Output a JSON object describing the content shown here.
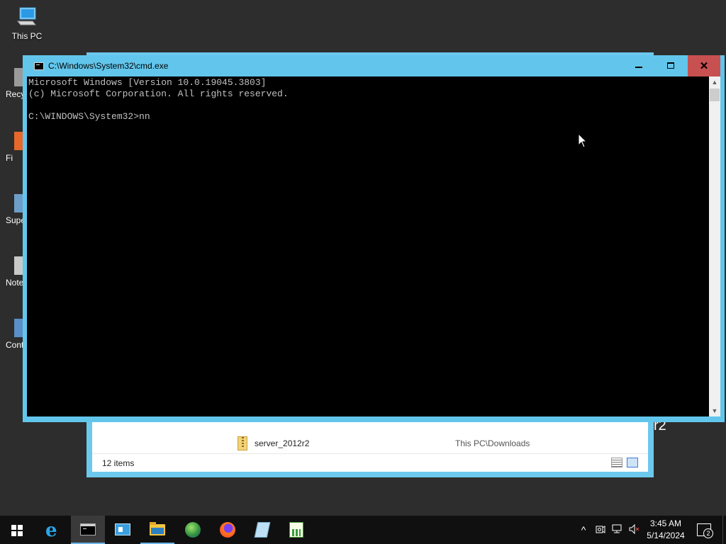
{
  "desktop": {
    "this_pc_label": "This PC",
    "partial_icons": [
      {
        "label": "Recy",
        "icon": "recycle-bin-icon"
      },
      {
        "label": "Fi",
        "icon": "firefox-icon"
      },
      {
        "label": "Supe",
        "icon": "superputty-icon"
      },
      {
        "label": "Note",
        "icon": "notepad-icon"
      },
      {
        "label": "Contr",
        "icon": "control-panel-icon"
      }
    ]
  },
  "explorer": {
    "row": {
      "name": "server_2012r2",
      "location": "This PC\\Downloads",
      "icon": "zip-folder-icon"
    },
    "status": {
      "item_count": "12 items"
    },
    "peek_text": "r2"
  },
  "cmd_window": {
    "title": "C:\\Windows\\System32\\cmd.exe",
    "minimize_glyph": "",
    "close_glyph": "✕",
    "lines": [
      "Microsoft Windows [Version 10.0.19045.3803]",
      "(c) Microsoft Corporation. All rights reserved.",
      "",
      "C:\\WINDOWS\\System32>nn"
    ],
    "scroll_up_glyph": "▲",
    "scroll_down_glyph": "▼"
  },
  "taskbar": {
    "apps": [
      {
        "name": "start-button",
        "icon": "windows-logo-icon"
      },
      {
        "name": "internet-explorer",
        "icon": "internet-explorer-icon"
      },
      {
        "name": "command-prompt",
        "icon": "command-prompt-icon",
        "state": "active"
      },
      {
        "name": "server-manager",
        "icon": "server-manager-icon"
      },
      {
        "name": "file-explorer",
        "icon": "folder-icon",
        "state": "open"
      },
      {
        "name": "chrome-like-browser",
        "icon": "globe-icon"
      },
      {
        "name": "firefox",
        "icon": "firefox-icon"
      },
      {
        "name": "notepad",
        "icon": "notepad-icon"
      },
      {
        "name": "chart-app",
        "icon": "chart-icon"
      }
    ],
    "tray": {
      "chevron_glyph": "^",
      "time": "3:45 AM",
      "date": "5/14/2024",
      "notification_count": "2"
    }
  },
  "colors": {
    "window_frame": "#62c6ec",
    "close_button": "#c75050",
    "console_bg": "#000000",
    "console_text": "#c0c0c0",
    "taskbar_bg": "#101010",
    "accent": "#6cb4e8"
  }
}
